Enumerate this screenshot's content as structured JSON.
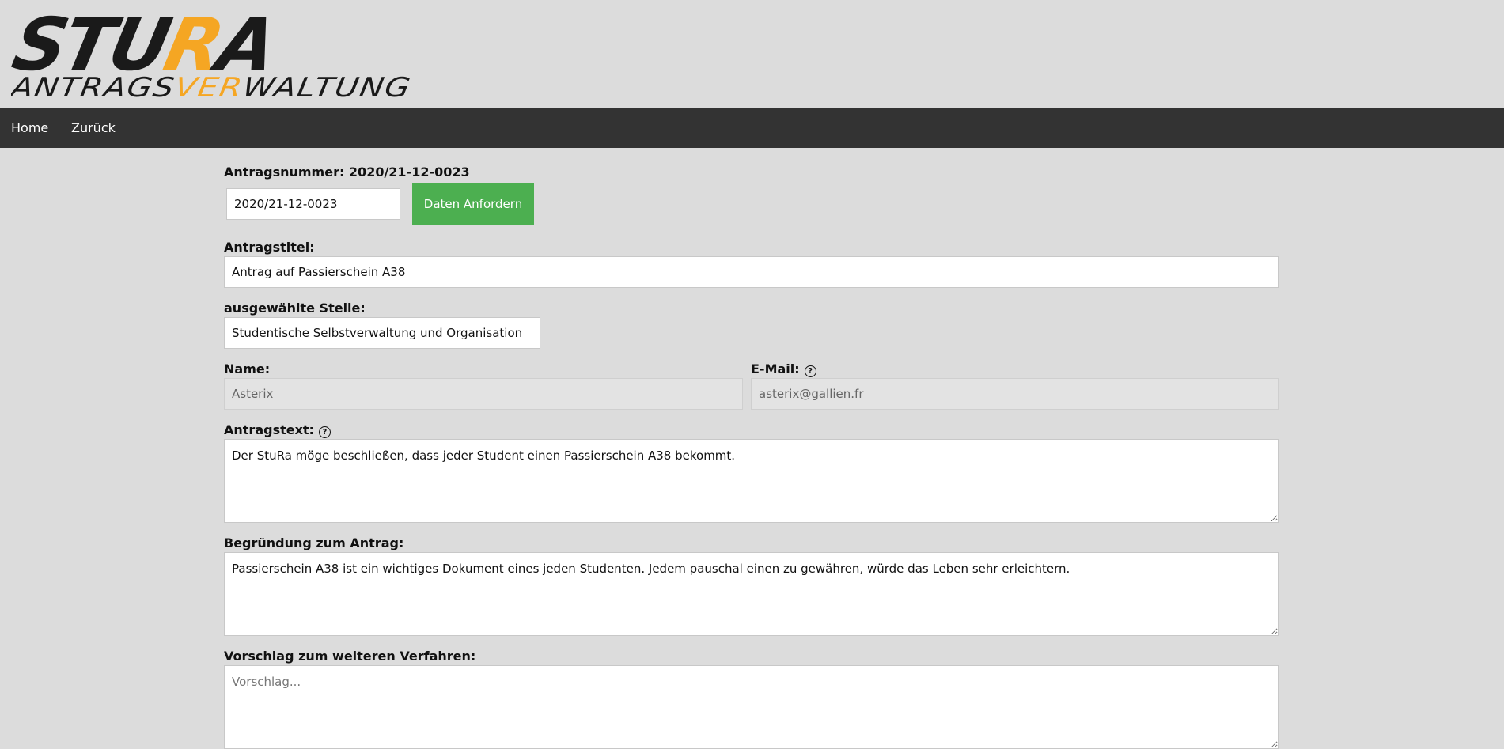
{
  "logo": {
    "word_top": "STURA",
    "word_top_left": "STU",
    "word_top_accent": "R",
    "word_top_right": "A",
    "word_bottom_left": "ANTRAGS",
    "word_bottom_accent": "VER",
    "word_bottom_right": "WALTUNG",
    "colors": {
      "dark": "#1a1a1a",
      "accent": "#f5a623"
    }
  },
  "nav": {
    "home": "Home",
    "back": "Zurück"
  },
  "form": {
    "antragsnummer_label": "Antragsnummer: 2020/21-12-0023",
    "antragsnummer_value": "2020/21-12-0023",
    "request_button": "Daten Anfordern",
    "titel_label": "Antragstitel:",
    "titel_value": "Antrag auf Passierschein A38",
    "stelle_label": "ausgewählte Stelle:",
    "stelle_value": "Studentische Selbstverwaltung und Organisation",
    "name_label": "Name:",
    "name_value": "Asterix",
    "email_label": "E-Mail:",
    "email_value": "asterix@gallien.fr",
    "help_glyph": "?",
    "antragstext_label": "Antragstext:",
    "antragstext_value": "Der StuRa möge beschließen, dass jeder Student einen Passierschein A38 bekommt.",
    "begruendung_label": "Begründung zum Antrag:",
    "begruendung_value": "Passierschein A38 ist ein wichtiges Dokument eines jeden Studenten. Jedem pauschal einen zu gewähren, würde das Leben sehr erleichtern.",
    "vorschlag_label": "Vorschlag zum weiteren Verfahren:",
    "vorschlag_placeholder": "Vorschlag..."
  },
  "colors": {
    "background": "#dcdcdc",
    "navbar": "#333333",
    "button": "#4caf50"
  }
}
